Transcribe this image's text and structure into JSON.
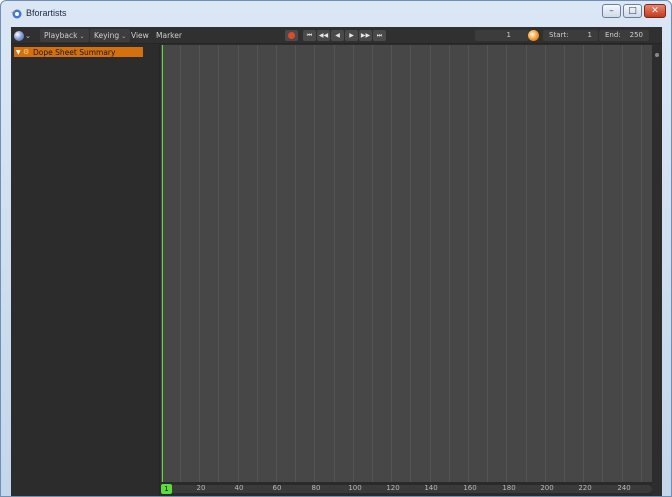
{
  "window": {
    "title": "Bforartists",
    "controls": [
      "minimize",
      "maximize",
      "close"
    ]
  },
  "header": {
    "editor_type_icon": "dopesheet-editor-icon",
    "menus": [
      {
        "label": "Playback",
        "dropdown": true
      },
      {
        "label": "Keying",
        "dropdown": true
      },
      {
        "label": "View",
        "dropdown": false
      },
      {
        "label": "Marker",
        "dropdown": false
      }
    ],
    "transport_icons": [
      "record-icon",
      "jump-start-icon",
      "jump-prev-key-icon",
      "play-reverse-icon",
      "play-icon",
      "jump-next-key-icon",
      "jump-end-icon"
    ],
    "current_frame": "1",
    "start_label": "Start:",
    "start_value": "1",
    "end_label": "End:",
    "end_value": "250"
  },
  "channels": {
    "summary_label": "Dope Sheet Summary"
  },
  "timeline": {
    "current_frame_label": "1",
    "ruler_ticks": [
      "20",
      "40",
      "60",
      "80",
      "100",
      "120",
      "140",
      "160",
      "180",
      "200",
      "220",
      "240"
    ]
  },
  "colors": {
    "background": "#474747",
    "summary_row": "#d5700e",
    "playhead": "#5bdb3c",
    "record": "#e04a2c"
  }
}
